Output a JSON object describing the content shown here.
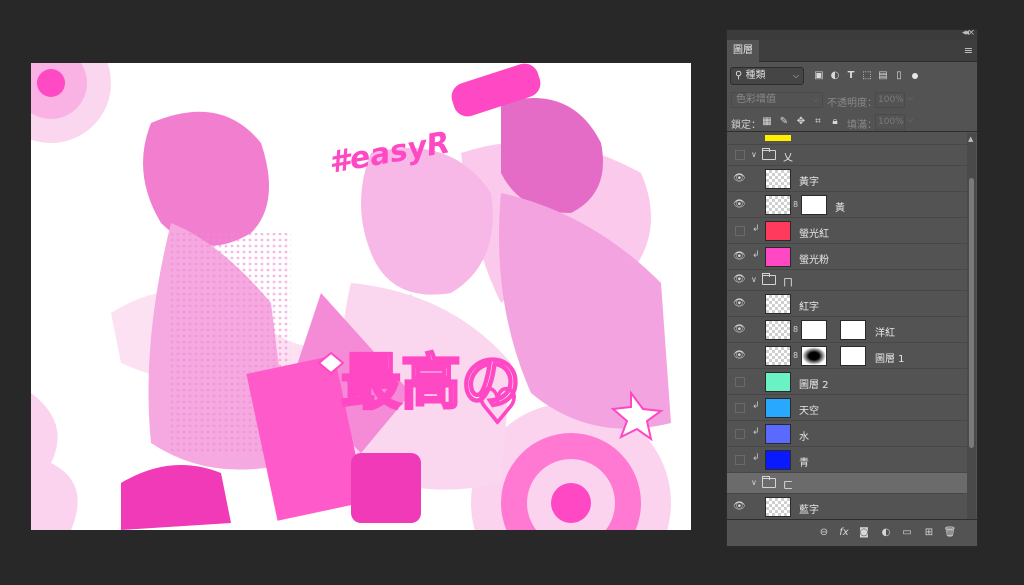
{
  "panel": {
    "tab_label": "圖層",
    "filter": {
      "kind_label": "種類",
      "icons": [
        "image-filter-icon",
        "adjustment-filter-icon",
        "type-filter-icon",
        "shape-filter-icon",
        "smart-object-filter-icon"
      ]
    },
    "blend_mode": "色彩增值",
    "opacity_label": "不透明度：",
    "opacity_value": "100%",
    "lock_label": "鎖定：",
    "fill_label": "填滿：",
    "fill_value": "100%"
  },
  "layers": [
    {
      "name": "",
      "kind": "yellow-strip",
      "color": "#ffee00"
    },
    {
      "name": "乂",
      "kind": "group",
      "visible": false,
      "expanded": true
    },
    {
      "name": "黃字",
      "kind": "pixel",
      "visible": true,
      "clipped": false
    },
    {
      "name": "黃",
      "kind": "pixel-mask",
      "visible": true,
      "clipped": false
    },
    {
      "name": "螢光紅",
      "kind": "fill",
      "visible": false,
      "clipped": true,
      "color": "#ff3a5c"
    },
    {
      "name": "螢光粉",
      "kind": "fill",
      "visible": true,
      "clipped": true,
      "color": "#ff48c4"
    },
    {
      "name": "ㄇ",
      "kind": "group",
      "visible": true,
      "expanded": true
    },
    {
      "name": "紅字",
      "kind": "pixel",
      "visible": true,
      "clipped": false
    },
    {
      "name": "洋紅",
      "kind": "pixel-mask2",
      "visible": true,
      "clipped": false
    },
    {
      "name": "圖層 1",
      "kind": "pixel-mask2",
      "visible": true,
      "clipped": false
    },
    {
      "name": "圖層 2",
      "kind": "fill",
      "visible": false,
      "clipped": false,
      "color": "#6af2c4"
    },
    {
      "name": "天空",
      "kind": "fill",
      "visible": false,
      "clipped": true,
      "color": "#28a8ff"
    },
    {
      "name": "水",
      "kind": "fill",
      "visible": false,
      "clipped": true,
      "color": "#5a6aff"
    },
    {
      "name": "青",
      "kind": "fill",
      "visible": false,
      "clipped": true,
      "color": "#0a1aff"
    },
    {
      "name": "ㄈ",
      "kind": "group",
      "visible": false,
      "expanded": true,
      "selected": true
    },
    {
      "name": "藍字",
      "kind": "pixel",
      "visible": true,
      "clipped": false
    }
  ],
  "canvas": {
    "hashtag": "#easyR",
    "main_text": "最高の",
    "accent": "#ff48c4"
  }
}
